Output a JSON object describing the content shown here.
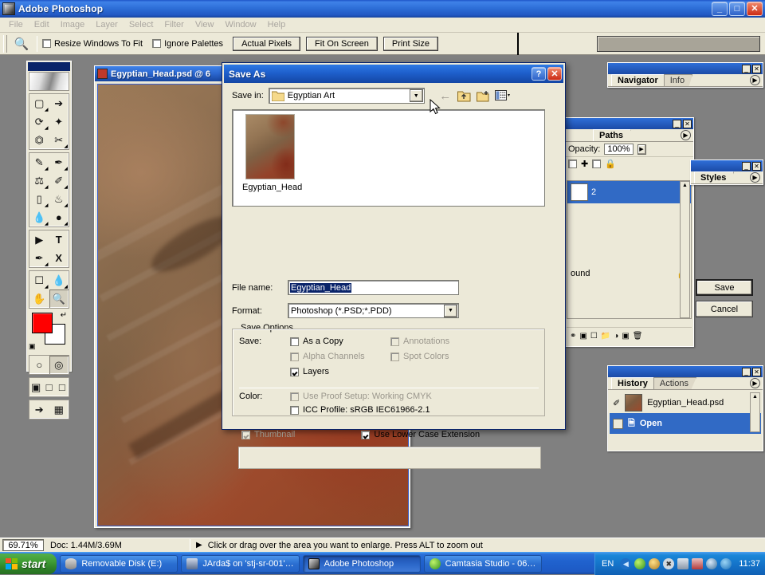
{
  "app": {
    "title": "Adobe Photoshop",
    "window_buttons": {
      "minimize": "_",
      "maximize": "□",
      "close": "✕"
    }
  },
  "menubar": {
    "items": [
      "File",
      "Edit",
      "Image",
      "Layer",
      "Select",
      "Filter",
      "View",
      "Window",
      "Help"
    ]
  },
  "options_bar": {
    "tool_icon": "zoom-tool-icon",
    "checkboxes": [
      {
        "label": "Resize Windows To Fit",
        "checked": false
      },
      {
        "label": "Ignore Palettes",
        "checked": false
      }
    ],
    "buttons": [
      "Actual Pixels",
      "Fit On Screen",
      "Print Size"
    ]
  },
  "toolbox": {
    "tools": [
      [
        "marquee-tool",
        "move-tool"
      ],
      [
        "lasso-tool",
        "magic-wand-tool"
      ],
      [
        "crop-tool",
        "slice-tool"
      ],
      [
        "healing-brush-tool",
        "brush-tool"
      ],
      [
        "clone-stamp-tool",
        "history-brush-tool"
      ],
      [
        "eraser-tool",
        "gradient-paint-bucket-tool"
      ],
      [
        "blur-tool",
        "dodge-burn-tool"
      ],
      [
        "path-selection-tool",
        "type-tool"
      ],
      [
        "pen-tool",
        "notes-tool"
      ],
      [
        "shape-tool",
        "eyedropper-tool"
      ],
      [
        "hand-tool",
        "zoom-tool"
      ]
    ],
    "foreground_color": "#ff0000",
    "background_color": "#ffffff"
  },
  "document": {
    "title": "Egyptian_Head.psd @ 6",
    "icon": "photoshop-document-icon"
  },
  "palettes": {
    "navigator": {
      "tabs": [
        "Navigator",
        "Info"
      ],
      "active": "Navigator"
    },
    "layers": {
      "tabs": [
        "Paths"
      ],
      "opacity_label": "Opacity:",
      "opacity_value": "100%",
      "lock_label": "",
      "rows": [
        {
          "name": "2",
          "selected": true
        },
        {
          "name": "ound",
          "selected": false
        }
      ]
    },
    "styles": {
      "tabs": [
        "Styles"
      ],
      "active": "Styles"
    },
    "history": {
      "tabs": [
        "History",
        "Actions"
      ],
      "active": "History",
      "snapshot": "Egyptian_Head.psd",
      "states": [
        {
          "label": "Open",
          "selected": true
        }
      ]
    }
  },
  "status_bar": {
    "zoom": "69.71%",
    "doc_size": "Doc: 1.44M/3.69M",
    "arrow": "▶",
    "hint": "Click or drag over the area you want to enlarge. Press ALT to zoom out"
  },
  "save_as_dialog": {
    "title": "Save As",
    "help_button": "?",
    "close_button": "✕",
    "save_in_label": "Save in:",
    "save_in_value": "Egyptian Art",
    "nav_icons": [
      "back-arrow-icon",
      "up-one-level-icon",
      "new-folder-icon",
      "views-menu-icon"
    ],
    "file_list": [
      {
        "name": "Egyptian_Head",
        "type": "image-thumbnail"
      }
    ],
    "file_name_label": "File name:",
    "file_name_value": "Egyptian_Head",
    "format_label": "Format:",
    "format_value": "Photoshop (*.PSD;*.PDD)",
    "save_button": "Save",
    "cancel_button": "Cancel",
    "save_options": {
      "legend": "Save Options",
      "save_label": "Save:",
      "color_label": "Color:",
      "checkboxes": [
        {
          "label": "As a Copy",
          "checked": false,
          "disabled": false
        },
        {
          "label": "Annotations",
          "checked": false,
          "disabled": true
        },
        {
          "label": "Alpha Channels",
          "checked": false,
          "disabled": true
        },
        {
          "label": "Spot Colors",
          "checked": false,
          "disabled": true
        },
        {
          "label": "Layers",
          "checked": true,
          "disabled": false
        },
        {
          "label": "Use Proof Setup:  Working CMYK",
          "checked": false,
          "disabled": true
        },
        {
          "label": "ICC Profile:  sRGB IEC61966-2.1",
          "checked": false,
          "disabled": false
        }
      ]
    },
    "thumbnail_checkbox": {
      "label": "Thumbnail",
      "checked": true,
      "disabled": true
    },
    "lowercase_checkbox": {
      "label": "Use Lower Case Extension",
      "checked": true,
      "disabled": false
    }
  },
  "taskbar": {
    "start_label": "start",
    "tasks": [
      {
        "label": "Removable Disk (E:)",
        "icon": "removable-disk-icon",
        "active": false
      },
      {
        "label": "JArda$ on 'stj-sr-001'…",
        "icon": "network-drive-icon",
        "active": false
      },
      {
        "label": "Adobe Photoshop",
        "icon": "photoshop-icon",
        "active": true
      },
      {
        "label": "Camtasia Studio - 06…",
        "icon": "camtasia-icon",
        "active": false
      }
    ],
    "language": "EN",
    "tray_icons": [
      "chevron-left-icon",
      "camtasia-tray-icon",
      "speaker-tray-icon",
      "shield-tray-icon",
      "network-tray-icon",
      "network-disconnected-icon",
      "volume-tray-icon",
      "update-tray-icon"
    ],
    "clock": "11:37"
  },
  "colors": {
    "titlebar_blue": "#1e56c8",
    "selection_blue": "#316ac5",
    "dialog_face": "#ece9d8",
    "accent_red": "#ff0000"
  }
}
